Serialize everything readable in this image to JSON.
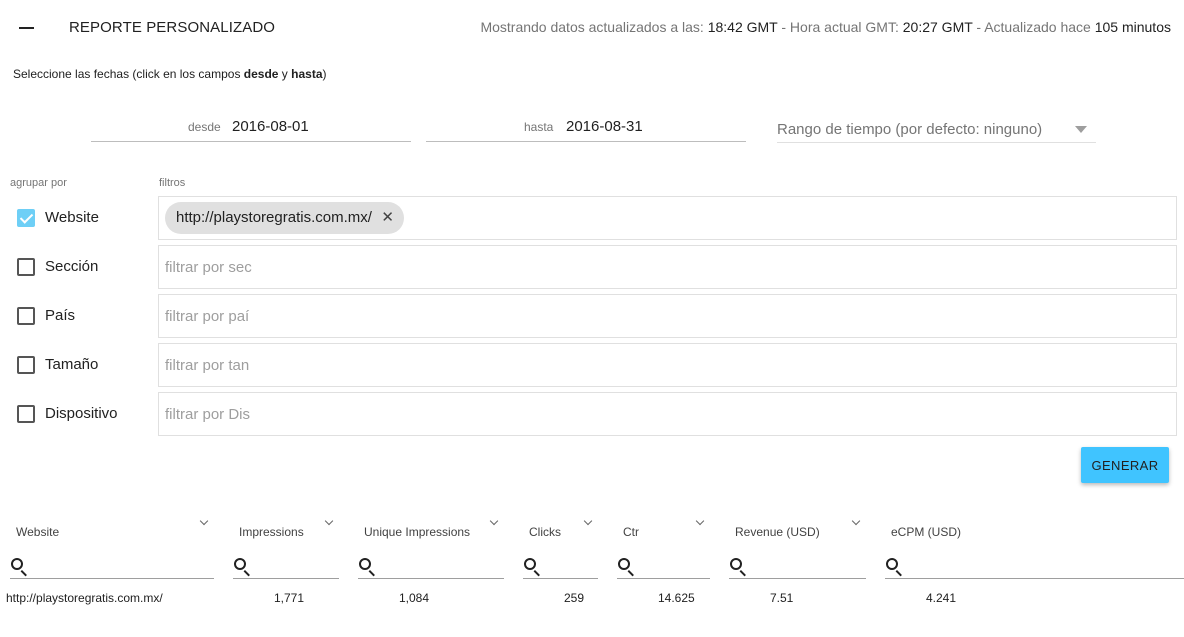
{
  "header": {
    "title": "REPORTE PERSONALIZADO",
    "status": {
      "prefix": "Mostrando datos actualizados a las: ",
      "data_time": "18:42 GMT",
      "mid": " - Hora actual GMT: ",
      "current_time": "20:27 GMT",
      "suffix": " - Actualizado hace ",
      "ago": "105 minutos"
    }
  },
  "instructions": {
    "text1": "Seleccione las fechas (click en los campos ",
    "from_word": "desde",
    "text2": " y ",
    "to_word": "hasta",
    "text3": ")"
  },
  "dates": {
    "from_label": "desde",
    "from_value": "2016-08-01",
    "to_label": "hasta",
    "to_value": "2016-08-31"
  },
  "range_select": {
    "selected": "Rango de tiempo (por defecto: ninguno)"
  },
  "labels": {
    "group_by": "agrupar por",
    "filters": "filtros"
  },
  "groups": [
    {
      "label": "Website",
      "checked": true
    },
    {
      "label": "Sección",
      "checked": false
    },
    {
      "label": "País",
      "checked": false
    },
    {
      "label": "Tamaño",
      "checked": false
    },
    {
      "label": "Dispositivo",
      "checked": false
    }
  ],
  "filters": {
    "website_chip": "http://playstoregratis.com.mx/",
    "chip_remove": "✕",
    "seccion_placeholder": "filtrar por sec",
    "pais_placeholder": "filtrar por paí",
    "tamano_placeholder": "filtrar por tan",
    "dispositivo_placeholder": "filtrar por Dis"
  },
  "generate_label": "GENERAR",
  "table": {
    "columns": [
      "Website",
      "Impressions",
      "Unique Impressions",
      "Clicks",
      "Ctr",
      "Revenue (USD)",
      "eCPM (USD)"
    ],
    "rows": [
      [
        "http://playstoregratis.com.mx/",
        "1,771",
        "1,084",
        "259",
        "14.625",
        "7.51",
        "4.241"
      ]
    ]
  },
  "colors": {
    "accent_button": "#40c4ff",
    "checkbox_checked": "#6ecff6",
    "chip_bg": "#e0e0e0"
  },
  "icons": {
    "collapse": "minus-icon",
    "chip_remove": "close-icon",
    "range_dropdown": "caret-down-icon",
    "sort": "chevron-down-icon",
    "search": "search-icon"
  }
}
